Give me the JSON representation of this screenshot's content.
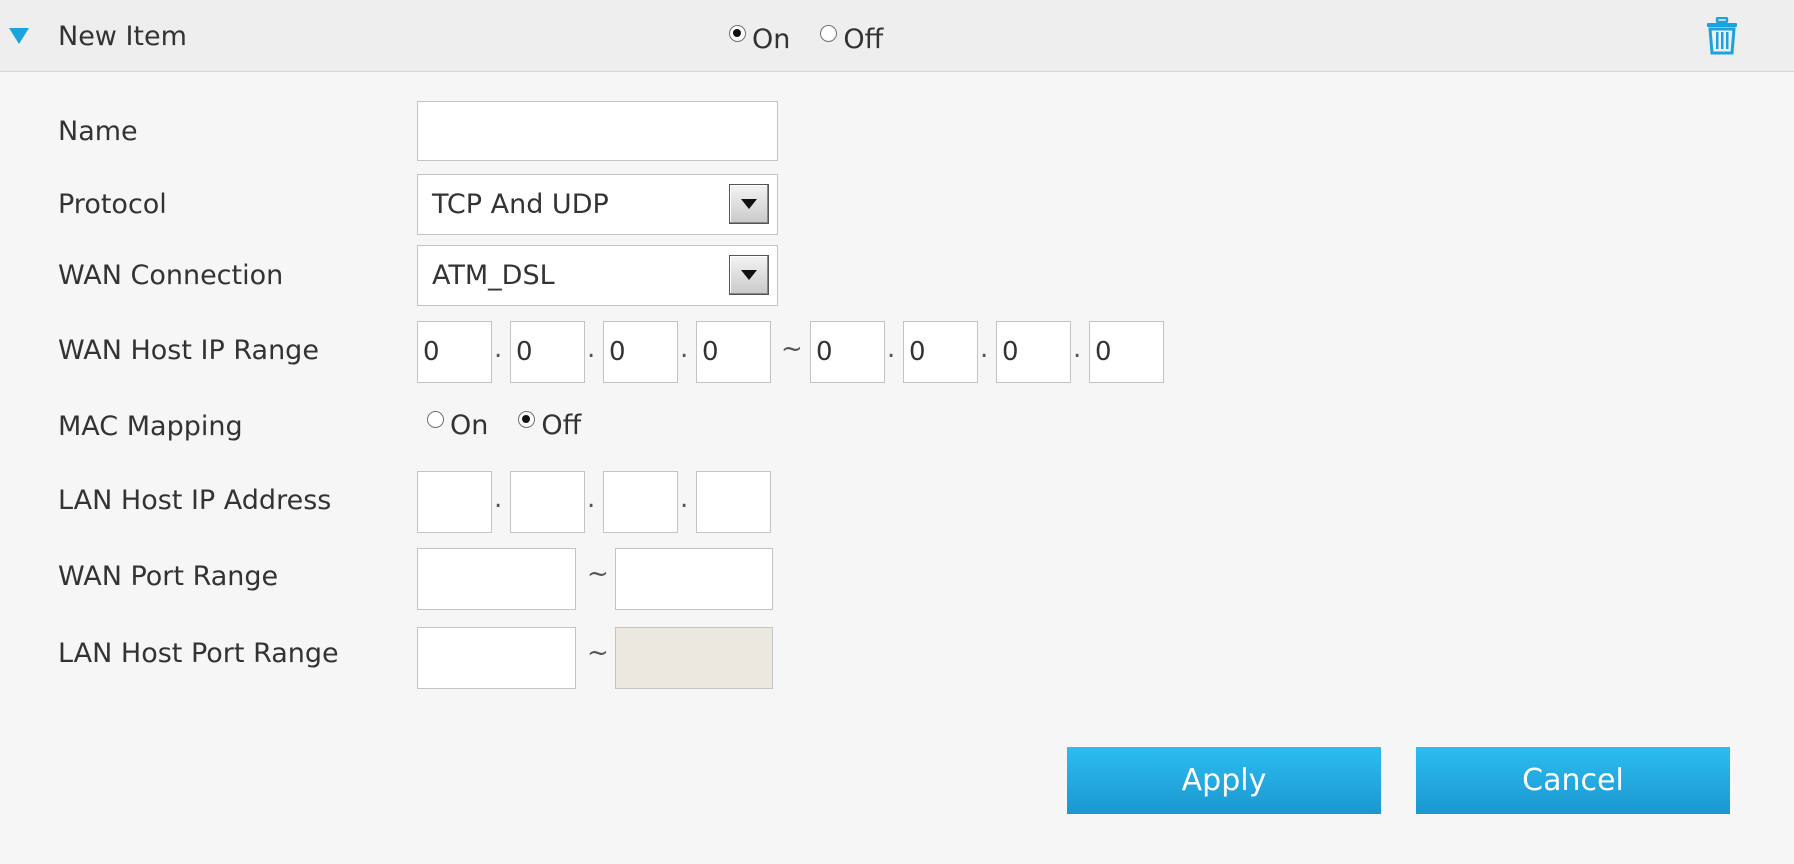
{
  "header": {
    "title": "New Item",
    "status_on_label": "On",
    "status_off_label": "Off",
    "status_selected": "On"
  },
  "form": {
    "name": {
      "label": "Name",
      "value": ""
    },
    "protocol": {
      "label": "Protocol",
      "value": "TCP And UDP"
    },
    "wan_connection": {
      "label": "WAN Connection",
      "value": "ATM_DSL"
    },
    "wan_host_ip_range": {
      "label": "WAN Host IP Range",
      "start": [
        "0",
        "0",
        "0",
        "0"
      ],
      "end": [
        "0",
        "0",
        "0",
        "0"
      ],
      "dot": ".",
      "tilde": "~"
    },
    "mac_mapping": {
      "label": "MAC Mapping",
      "on_label": "On",
      "off_label": "Off",
      "selected": "Off"
    },
    "lan_host_ip": {
      "label": "LAN Host IP Address",
      "values": [
        "",
        "",
        "",
        ""
      ]
    },
    "wan_port_range": {
      "label": "WAN Port Range",
      "start": "",
      "end": ""
    },
    "lan_host_port_range": {
      "label": "LAN Host Port Range",
      "start": "",
      "end": ""
    }
  },
  "actions": {
    "apply": "Apply",
    "cancel": "Cancel"
  },
  "colors": {
    "accent": "#1ba3e0",
    "button": "#22a9e0",
    "disabled_input": "#ebe9df"
  }
}
